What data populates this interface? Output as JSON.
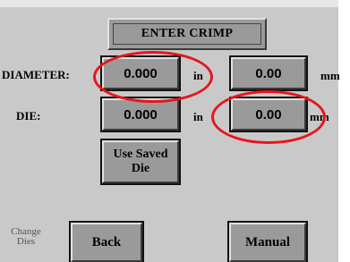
{
  "header": {
    "title": "ENTER CRIMP"
  },
  "diameter": {
    "label": "DIAMETER:",
    "in_value": "0.000",
    "in_unit": "in",
    "mm_value": "0.00",
    "mm_unit": "mm"
  },
  "die": {
    "label": "DIE:",
    "in_value": "0.000",
    "in_unit": "in",
    "mm_value": "0.00",
    "mm_unit": "mm"
  },
  "use_saved_die": {
    "line1": "Use Saved",
    "line2": "Die"
  },
  "footer": {
    "change_dies_line1": "Change",
    "change_dies_line2": "Dies",
    "back_label": "Back",
    "manual_label": "Manual"
  },
  "annotation_color": "#e8141a"
}
